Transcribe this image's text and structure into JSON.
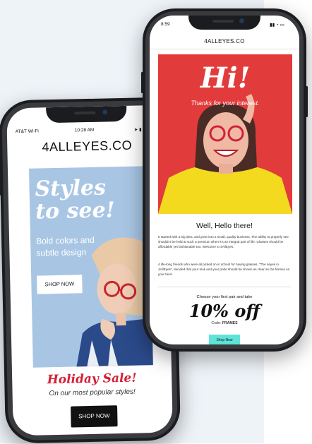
{
  "left_phone": {
    "status": {
      "carrier": "AT&T Wi-Fi",
      "time": "10:28 AM"
    },
    "logo": {
      "prefix": "4ALL",
      "suffix": "EYES.CO"
    },
    "hero": {
      "title_line1": "Styles",
      "title_line2": "to see!",
      "subtitle_line1": "Bold colors and",
      "subtitle_line2": "subtle design",
      "button": "SHOP NOW"
    },
    "promo": {
      "title": "Holiday Sale!",
      "subtitle": "On our most popular styles!",
      "button": "SHOP NOW"
    }
  },
  "right_phone": {
    "status": {
      "time": "8:59"
    },
    "logo": {
      "prefix": "4ALL",
      "suffix": "EYES.CO"
    },
    "hero": {
      "title": "Hi!",
      "subtitle": "Thanks for your interest."
    },
    "greeting": "Well, Hello there!",
    "paragraph1": "It started with a big idea, and grew into a small, quality business. The ability to properly see shouldn't be held at such a premium when it's an integral part of life. Glasses should be affordable yet fashionable too. Welcome to 4AllEyes.",
    "paragraph2": "4 life-long friends who were all picked on in school for having glasses, \"The 4eyes in 4AllEyes\", decided that your look and your pride should be shown as clear as the frames on your face!",
    "offer": {
      "intro": "Choose your first pair and take",
      "headline": "10% off",
      "code_label": "Code:",
      "code": "FRAMES",
      "button": "Shop Now"
    }
  },
  "colors": {
    "hero_blue": "#a8c6e4",
    "hero_red": "#e23b3b",
    "sale_red": "#d31f36",
    "teal": "#5fe3d8"
  }
}
